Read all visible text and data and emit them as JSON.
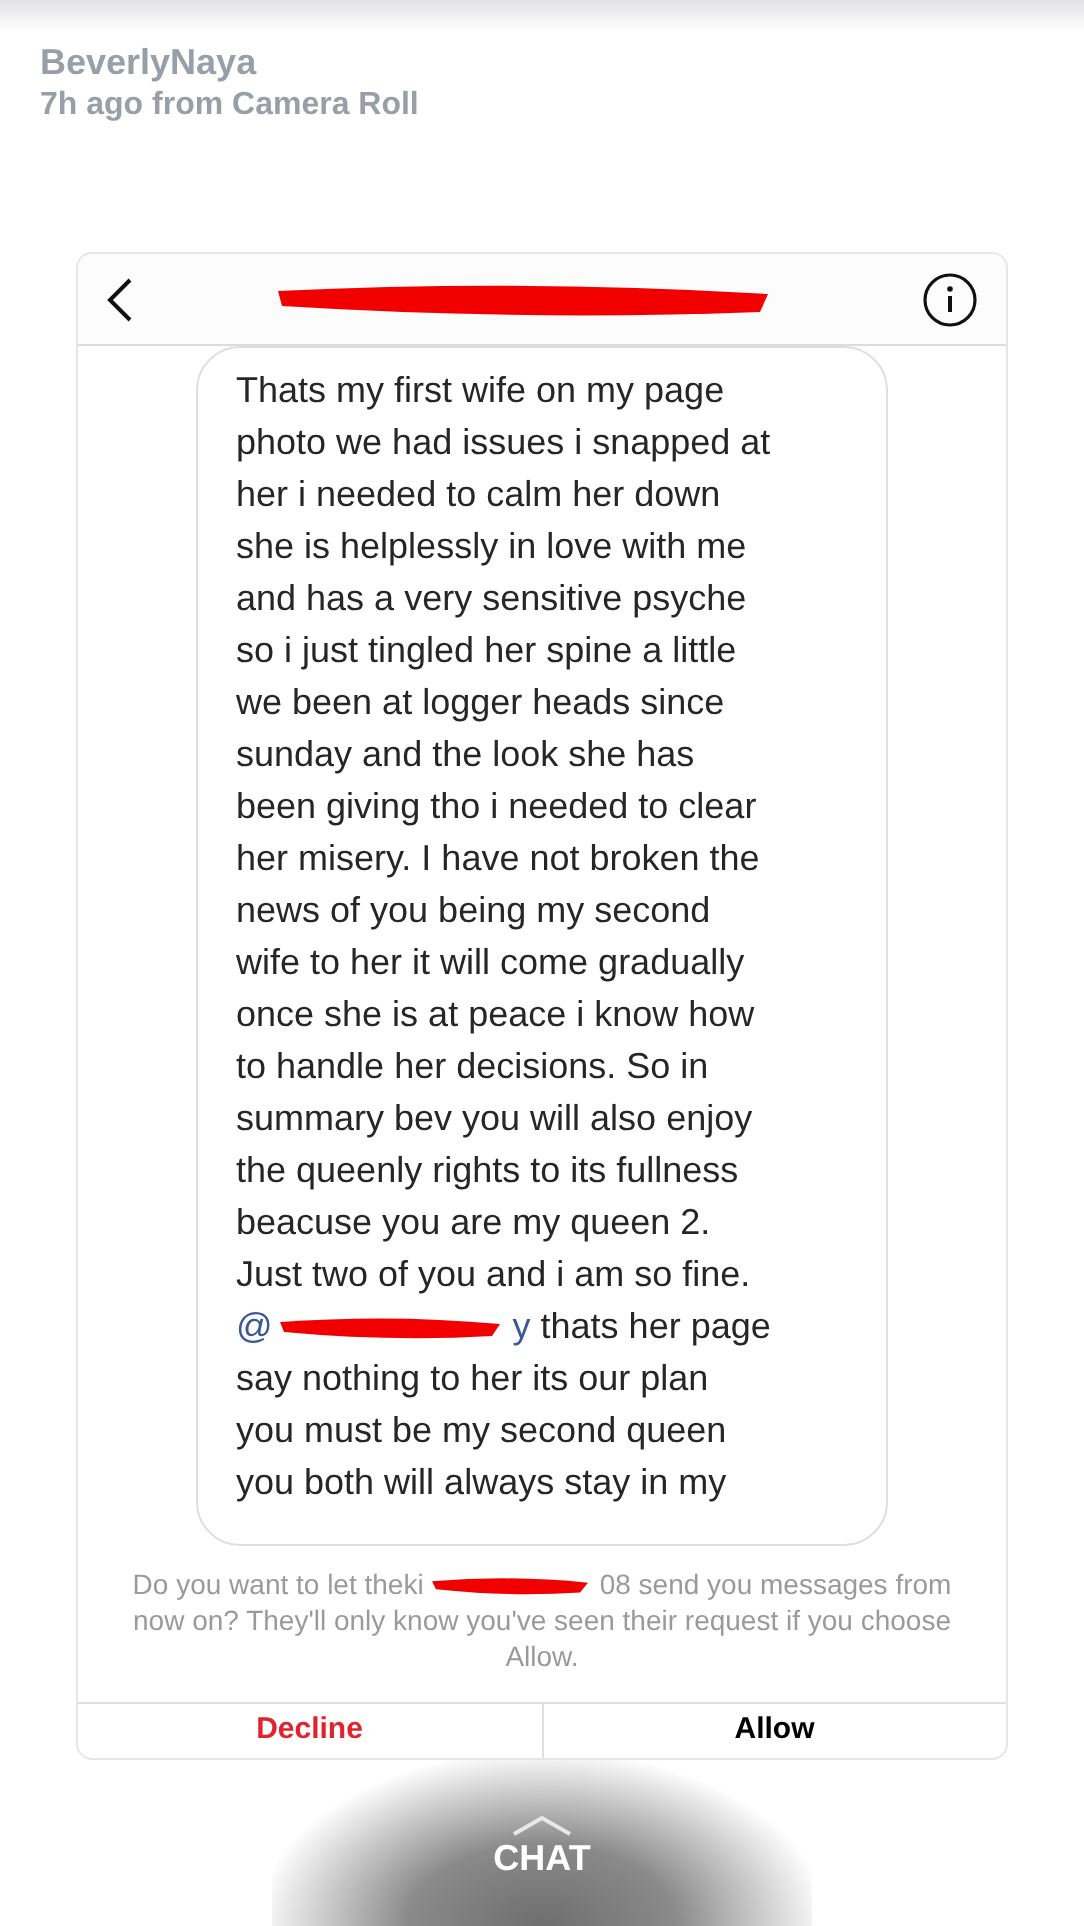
{
  "story": {
    "username": "BeverlyNaya",
    "meta": "7h ago from Camera Roll"
  },
  "message": {
    "lines_before": [
      "Thats my first wife on my page",
      "photo we had issues i snapped at",
      "her i needed to calm her down",
      "she is helplessly in love with me",
      "and has a very sensitive psyche",
      "so i just tingled her spine a little",
      "we been at logger heads since",
      "sunday and the look she has",
      "been giving tho i needed to clear",
      "her misery. I have not broken the",
      "news of you being my second",
      "wife to her it will come gradually",
      "once she is at peace i know how",
      "to handle her decisions. So in",
      "summary bev you will also enjoy",
      "the queenly rights to its fullness",
      "beacuse you are my queen 2.",
      "Just two of you and i am so fine."
    ],
    "mention_start": "@",
    "mention_end": "y",
    "after_mention": " thats her page",
    "lines_after": [
      "say nothing to her its our plan",
      "you must be my second queen",
      "you both will always stay in my"
    ]
  },
  "request": {
    "text_before": "Do you want to let theki",
    "text_after": "08 send you messages from now on? They'll only know you've seen their request if you choose Allow."
  },
  "buttons": [
    {
      "label": "Decline",
      "kind": "destructive"
    },
    {
      "label": "Allow",
      "kind": "default"
    }
  ],
  "chat_label": "CHAT"
}
